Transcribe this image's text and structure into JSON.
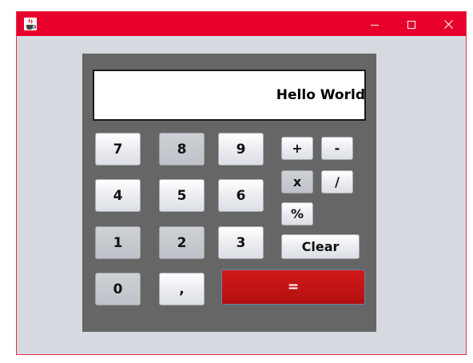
{
  "titlebar": {
    "app_icon": "java-cup-icon",
    "minimize_icon": "minimize-icon",
    "maximize_icon": "maximize-icon",
    "close_icon": "close-icon",
    "accent_color": "#e8002c"
  },
  "display": {
    "text": "Hello World"
  },
  "keys": {
    "k7": "7",
    "k8": "8",
    "k9": "9",
    "k4": "4",
    "k5": "5",
    "k6": "6",
    "k1": "1",
    "k2": "2",
    "k3": "3",
    "k0": "0",
    "comma": ",",
    "plus": "+",
    "minus": "-",
    "multiply": "x",
    "divide": "/",
    "percent": "%",
    "clear": "Clear",
    "equals": "="
  },
  "colors": {
    "panel": "#666666",
    "equals_button": "#c01212",
    "window_bg": "#d6d9e0"
  }
}
